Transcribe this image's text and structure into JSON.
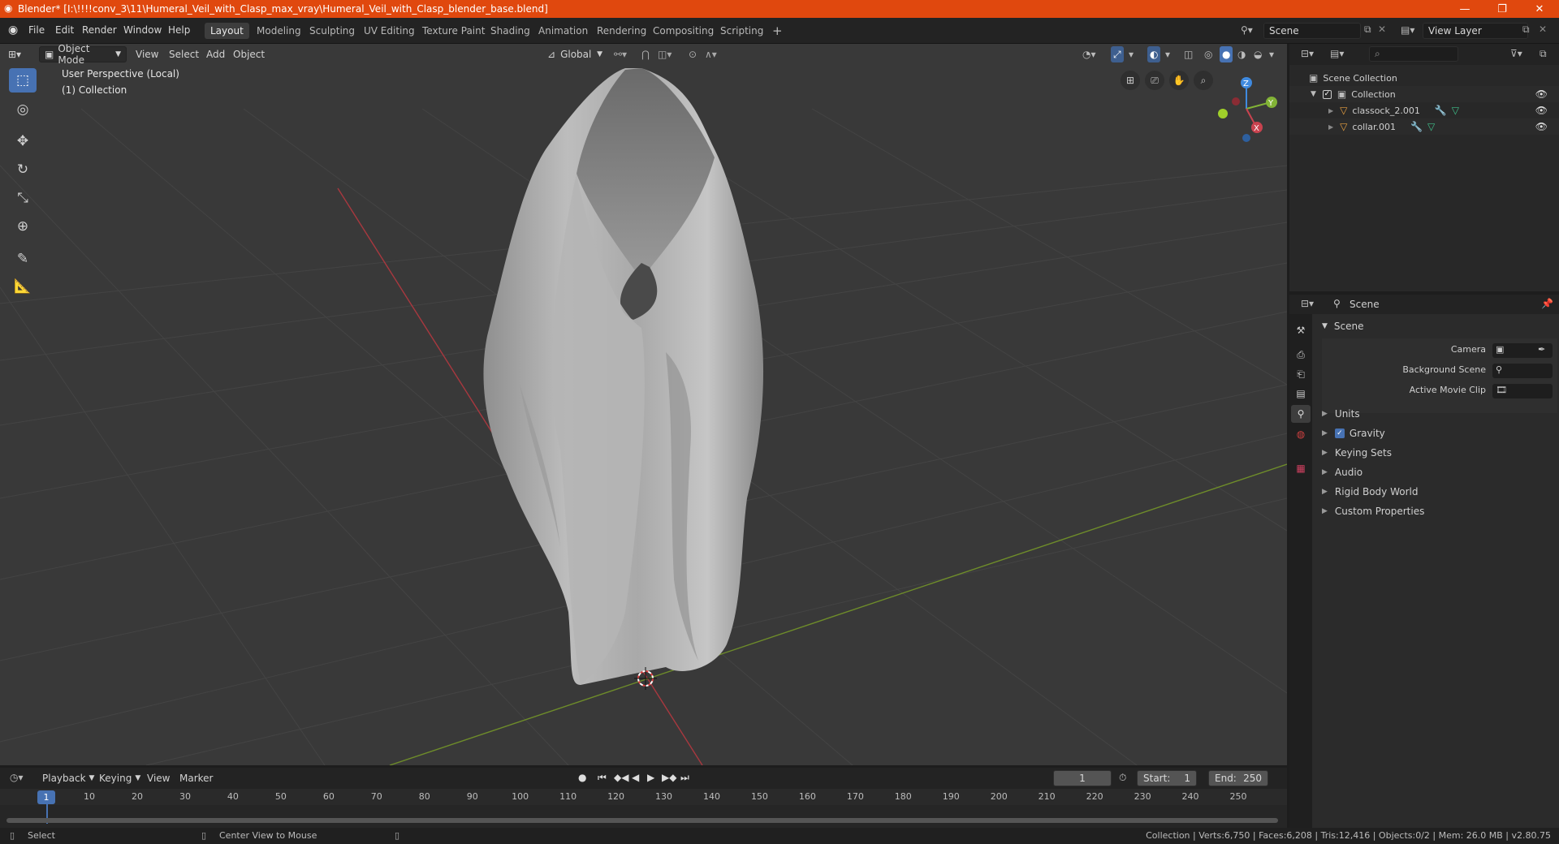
{
  "window": {
    "title": "Blender* [I:\\!!!!conv_3\\11\\Humeral_Veil_with_Clasp_max_vray\\Humeral_Veil_with_Clasp_blender_base.blend]",
    "controls": {
      "minimize": "—",
      "maximize": "❐",
      "close": "✕"
    }
  },
  "menu": [
    "File",
    "Edit",
    "Render",
    "Window",
    "Help"
  ],
  "workspaces": [
    "Layout",
    "Modeling",
    "Sculpting",
    "UV Editing",
    "Texture Paint",
    "Shading",
    "Animation",
    "Rendering",
    "Compositing",
    "Scripting"
  ],
  "active_workspace": "Layout",
  "add_workspace": "+",
  "scene_field": "Scene",
  "view_layer_field": "View Layer",
  "viewport": {
    "mode": "Object Mode",
    "menus": [
      "View",
      "Select",
      "Add",
      "Object"
    ],
    "orientation": "Global",
    "overlay_line1": "User Perspective (Local)",
    "overlay_line2": "(1) Collection",
    "gizmo_axes": {
      "z": "Z",
      "y": "Y",
      "x": "X"
    }
  },
  "outliner": {
    "root": "Scene Collection",
    "collection": "Collection",
    "objects": [
      "classock_2.001",
      "collar.001"
    ]
  },
  "properties": {
    "context": "Scene",
    "panel": "Scene",
    "fields": [
      {
        "label": "Camera"
      },
      {
        "label": "Background Scene"
      },
      {
        "label": "Active Movie Clip"
      }
    ],
    "sections": [
      "Units",
      "Gravity",
      "Keying Sets",
      "Audio",
      "Rigid Body World",
      "Custom Properties"
    ],
    "gravity_checked": true
  },
  "timeline": {
    "menus": [
      "Playback",
      "Keying",
      "View",
      "Marker"
    ],
    "current_frame": "1",
    "start_label": "Start:",
    "start": "1",
    "end_label": "End:",
    "end": "250",
    "ruler": [
      "1",
      "10",
      "20",
      "30",
      "40",
      "50",
      "60",
      "70",
      "80",
      "90",
      "100",
      "110",
      "120",
      "130",
      "140",
      "150",
      "160",
      "170",
      "180",
      "190",
      "200",
      "210",
      "220",
      "230",
      "240",
      "250"
    ]
  },
  "status": {
    "left_action": "Select",
    "middle_action": "Center View to Mouse",
    "stats": "Collection | Verts:6,750 | Faces:6,208 | Tris:12,416 | Objects:0/2 | Mem: 26.0 MB | v2.80.75"
  },
  "colors": {
    "accent": "#4772b3",
    "titlebar": "#e0480e",
    "x_axis": "#c9434f",
    "y_axis": "#82b336",
    "z_axis": "#3f8ae0"
  }
}
